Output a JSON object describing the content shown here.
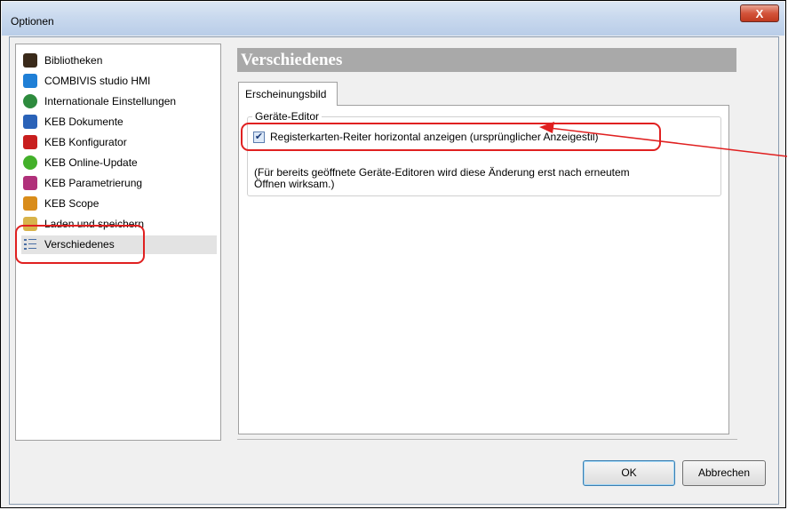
{
  "window": {
    "title": "Optionen",
    "close_glyph": "X"
  },
  "tree": {
    "items": [
      {
        "label": "Bibliotheken",
        "icon": "library-books-icon",
        "color": "#3a2a1a"
      },
      {
        "label": "COMBIVIS studio HMI",
        "icon": "hmi-screen-icon",
        "color": "#1f7fd6"
      },
      {
        "label": "Internationale Einstellungen",
        "icon": "globe-icon",
        "color": "#2e8b3e"
      },
      {
        "label": "KEB Dokumente",
        "icon": "keb-documents-icon",
        "color": "#2a62b8"
      },
      {
        "label": "KEB Konfigurator",
        "icon": "keb-configurator-icon",
        "color": "#c81e1e"
      },
      {
        "label": "KEB Online-Update",
        "icon": "online-update-icon",
        "color": "#43b02a"
      },
      {
        "label": "KEB Parametrierung",
        "icon": "keb-parameter-icon",
        "color": "#b0307a"
      },
      {
        "label": "KEB Scope",
        "icon": "keb-scope-icon",
        "color": "#d98c1a"
      },
      {
        "label": "Laden und speichern",
        "icon": "folder-save-icon",
        "color": "#d8b34a"
      },
      {
        "label": "Verschiedenes",
        "icon": "list-icon",
        "color": "#4a6fa5",
        "selected": true
      }
    ]
  },
  "panel": {
    "header": "Verschiedenes",
    "tab_label": "Erscheinungsbild",
    "group_title": "Geräte-Editor",
    "checkbox_label": "Registerkarten-Reiter horizontal anzeigen (ursprünglicher Anzeigestil)",
    "checkbox_checked": true,
    "checkbox_glyph": "✔",
    "note_line1": "(Für bereits geöffnete Geräte-Editoren wird diese Änderung erst nach erneutem",
    "note_line2": "Öffnen wirksam.)"
  },
  "buttons": {
    "ok": "OK",
    "cancel": "Abbrechen"
  },
  "annotation_color": "#e02020"
}
